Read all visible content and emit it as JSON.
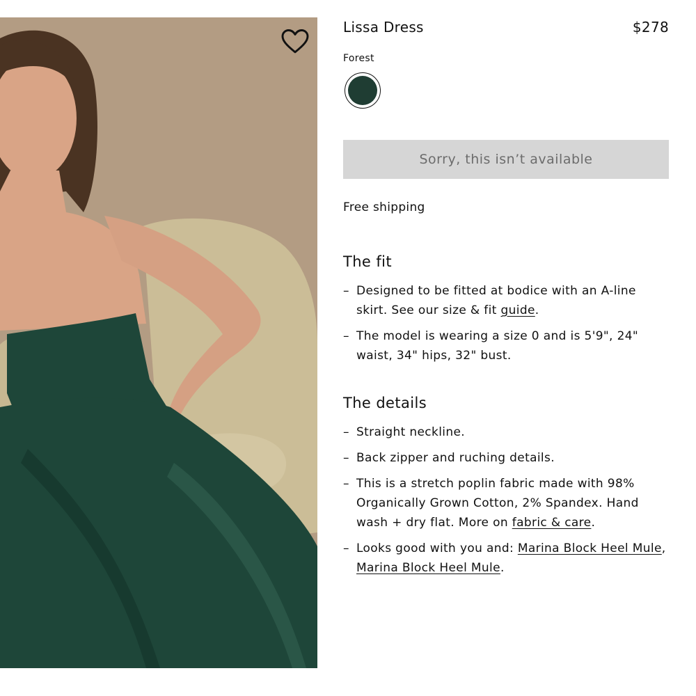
{
  "product": {
    "name": "Lissa Dress",
    "price": "$278",
    "color_label": "Forest",
    "swatch_color": "#1f3d33",
    "unavailable_label": "Sorry, this isn’t available",
    "shipping": "Free shipping"
  },
  "image": {
    "wishlist_icon": "heart-outline-icon"
  },
  "fit": {
    "title": "The fit",
    "items": [
      {
        "dash": "–",
        "text": "Designed to be fitted at bodice with an A-line skirt. See our size & fit ",
        "link": "guide",
        "after": "."
      },
      {
        "dash": "–",
        "text": "The model is wearing a size 0 and is 5'9\", 24\" waist, 34\" hips, 32\" bust."
      }
    ]
  },
  "details": {
    "title": "The details",
    "items": [
      {
        "dash": "–",
        "text": "Straight neckline."
      },
      {
        "dash": "–",
        "text": "Back zipper and ruching details."
      },
      {
        "dash": "–",
        "text": "This is a stretch poplin fabric made with 98% Organically Grown Cotton, 2% Spandex. Hand wash + dry flat. More on ",
        "link": "fabric & care",
        "after": "."
      },
      {
        "dash": "–",
        "text": "Looks good with you and: ",
        "link": "Marina Block Heel Mule",
        "mid": ", ",
        "link2": "Marina Block Heel Mule",
        "after": "."
      }
    ]
  },
  "colors": {
    "backdrop": "#b39c83",
    "chair": "#cbbd97",
    "dress": "#1e4639",
    "skin": "#d9a486",
    "hair": "#4a3322"
  }
}
